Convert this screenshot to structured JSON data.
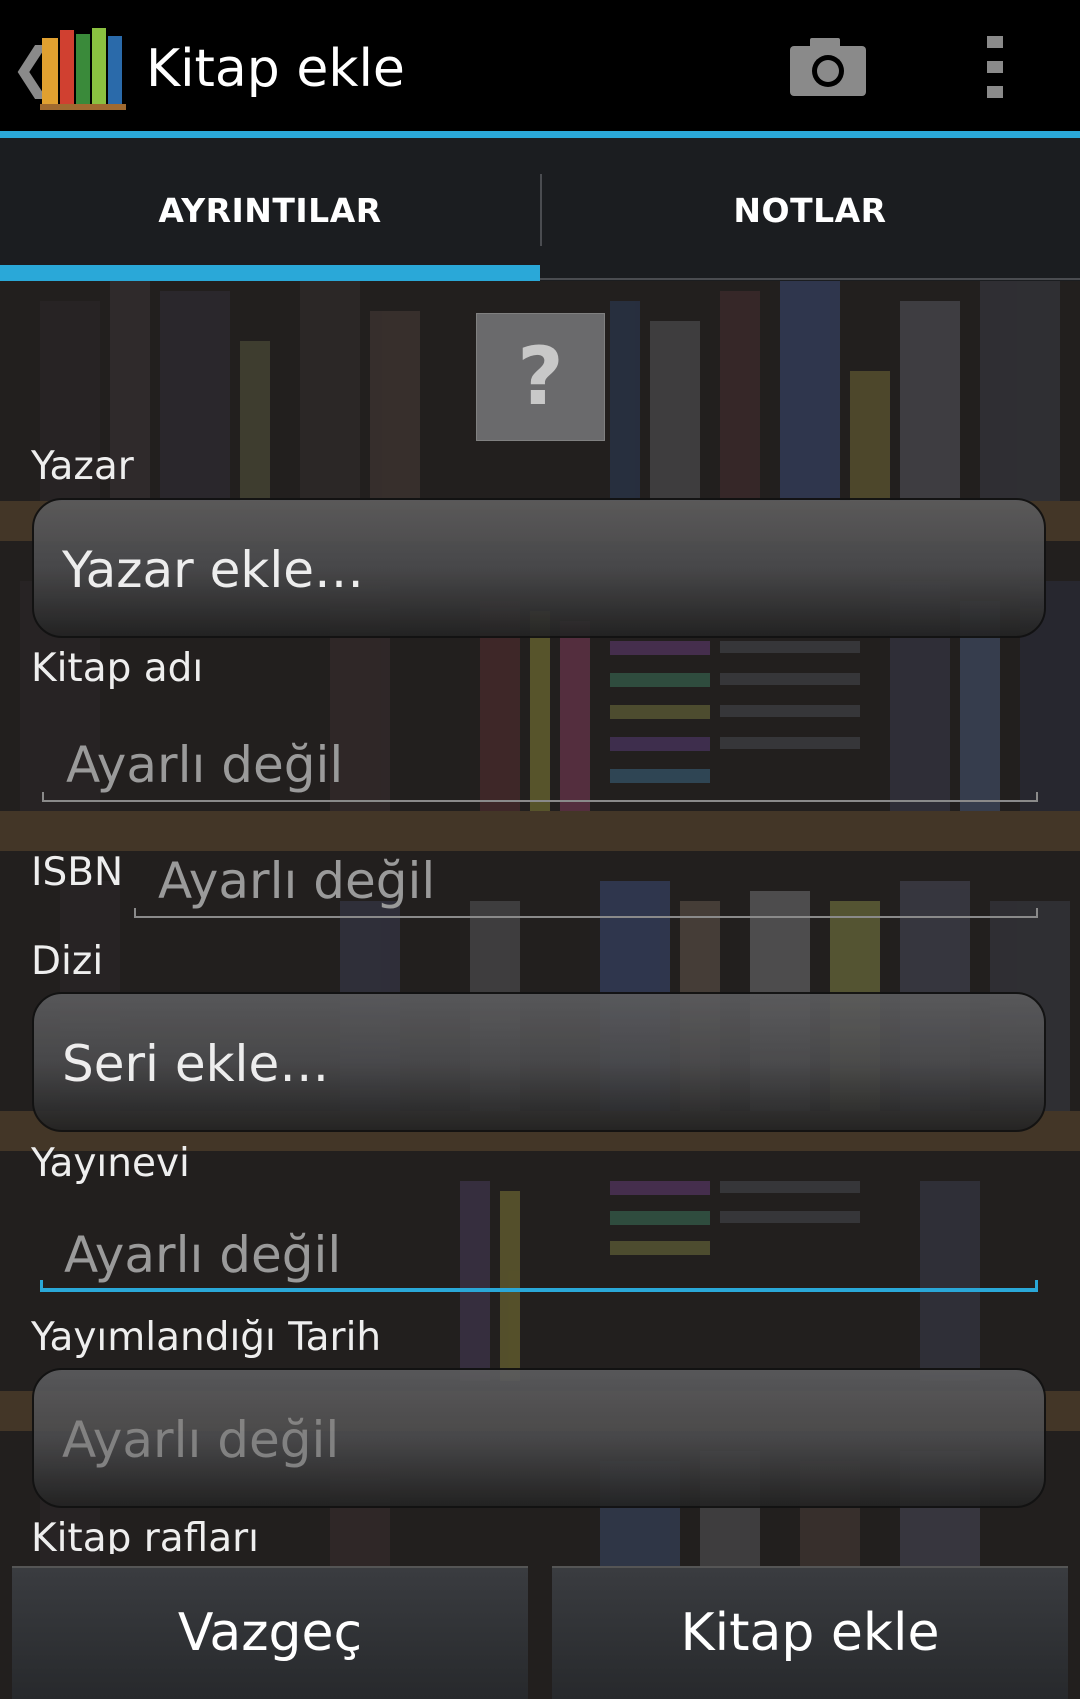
{
  "actionbar": {
    "title": "Kitap ekle",
    "back_glyph": "❮",
    "icons": [
      "app-bookshelf-icon",
      "camera-icon",
      "overflow-menu-icon"
    ]
  },
  "tabs": [
    {
      "label": "AYRINTILAR",
      "selected": true
    },
    {
      "label": "NOTLAR",
      "selected": false
    }
  ],
  "cover": {
    "glyph": "?"
  },
  "form": {
    "author_label": "Yazar",
    "author_value": "Yazar ekle…",
    "title_label": "Kitap adı",
    "title_placeholder": "Ayarlı değil",
    "isbn_label": "ISBN",
    "isbn_placeholder": "Ayarlı değil",
    "series_label": "Dizi",
    "series_value": "Seri ekle…",
    "publisher_label": "Yayınevi",
    "publisher_placeholder": "Ayarlı değil",
    "date_label": "Yayımlandığı Tarih",
    "date_placeholder": "Ayarlı değil",
    "shelves_label": "Kitap rafları"
  },
  "buttons": {
    "cancel": "Vazgeç",
    "add": "Kitap ekle"
  },
  "colors": {
    "accent": "#2aa8d8",
    "actionbar_bg": "#000000",
    "tab_bg": "#1b1d20"
  }
}
